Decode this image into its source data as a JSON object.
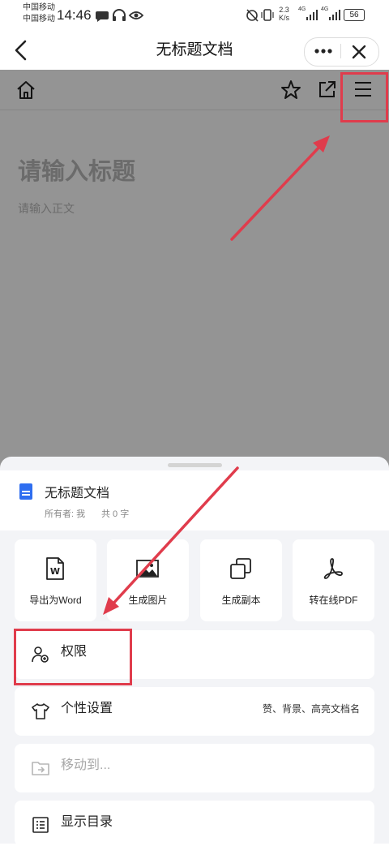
{
  "status_bar": {
    "carrier_1": "中国移动",
    "carrier_2": "中国移动",
    "time": "14:46",
    "net_speed_value": "2.3",
    "net_speed_unit": "K/s",
    "signal_1": "4G",
    "signal_2": "4G",
    "battery": "56"
  },
  "nav": {
    "title": "无标题文档"
  },
  "editor": {
    "title_placeholder": "请输入标题",
    "body_placeholder": "请输入正文"
  },
  "sheet": {
    "doc_title": "无标题文档",
    "owner": "所有者: 我",
    "word_count": "共 0 字",
    "tiles": [
      {
        "label": "导出为Word",
        "icon": "word-doc-icon"
      },
      {
        "label": "生成图片",
        "icon": "image-icon"
      },
      {
        "label": "生成副本",
        "icon": "copy-icon"
      },
      {
        "label": "转在线PDF",
        "icon": "pdf-icon"
      }
    ],
    "rows": [
      {
        "label": "权限",
        "icon": "user-permission-icon"
      },
      {
        "label": "个性设置",
        "icon": "shirt-icon",
        "right": "赞、背景、高亮文档名"
      },
      {
        "label": "移动到...",
        "icon": "folder-move-icon",
        "disabled": true
      },
      {
        "label": "显示目录",
        "icon": "outline-list-icon"
      }
    ]
  },
  "colors": {
    "overlay": "#000000",
    "highlight": "#e03c4c",
    "doc_icon": "#2f6ef0",
    "sheet_background": "#f3f4f7"
  }
}
